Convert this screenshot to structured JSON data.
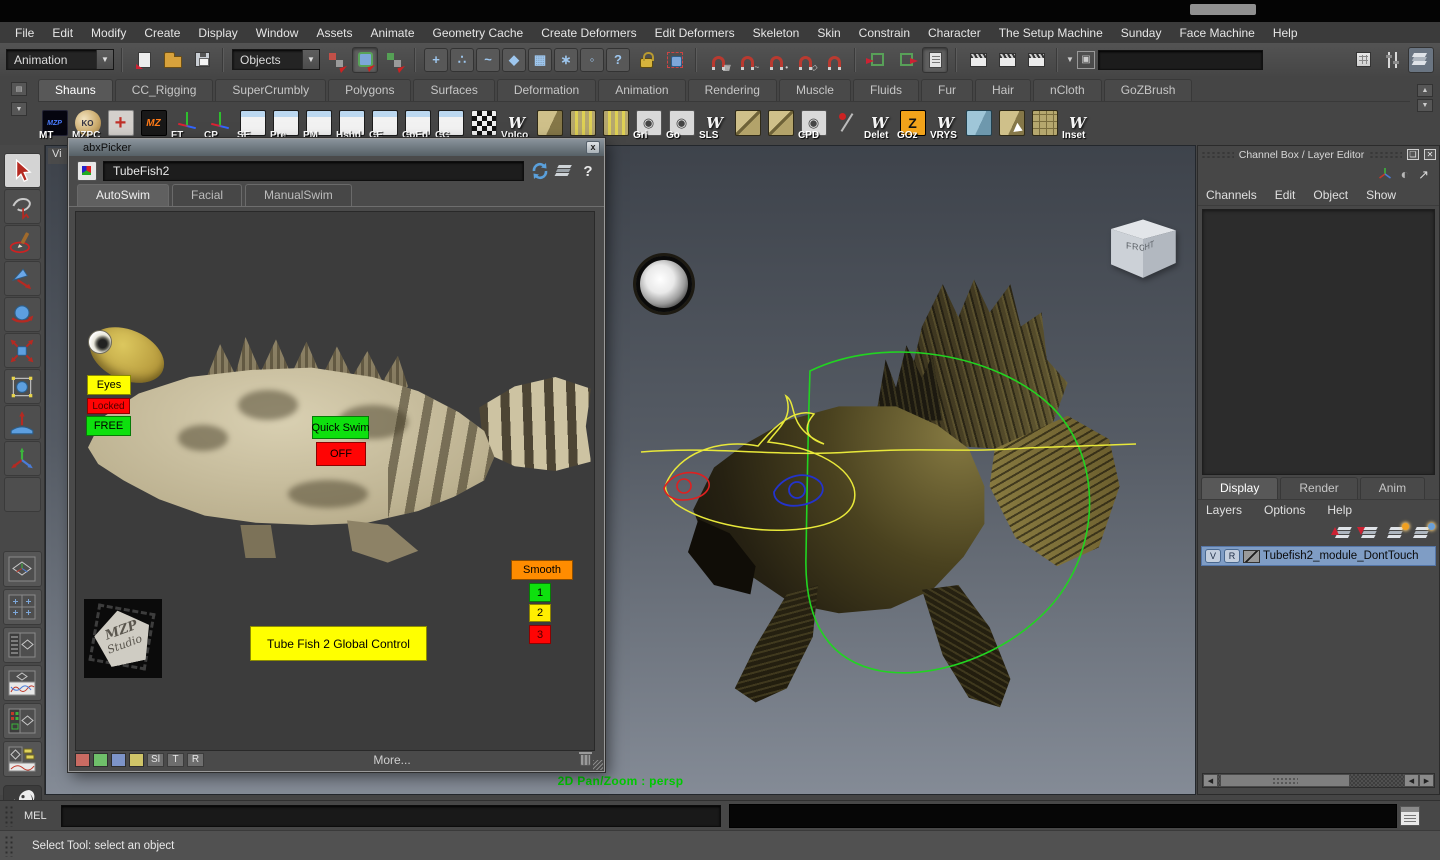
{
  "menubar": [
    "File",
    "Edit",
    "Modify",
    "Create",
    "Display",
    "Window",
    "Assets",
    "Animate",
    "Geometry Cache",
    "Create Deformers",
    "Edit Deformers",
    "Skeleton",
    "Skin",
    "Constrain",
    "Character",
    "The Setup Machine",
    "Sunday",
    "Face Machine",
    "Help"
  ],
  "statusline": {
    "menuset": "Animation",
    "selection_mask": "Objects",
    "component_mask_icons": [
      {
        "name": "select-all-icon",
        "glyph": "+"
      },
      {
        "name": "select-points-icon",
        "glyph": "∴"
      },
      {
        "name": "select-curves-icon",
        "glyph": "~"
      },
      {
        "name": "select-surfaces-icon",
        "glyph": "◆"
      },
      {
        "name": "select-hulls-icon",
        "glyph": "▦"
      },
      {
        "name": "select-deformations-icon",
        "glyph": "∗"
      },
      {
        "name": "select-dynamics-icon",
        "glyph": "◦"
      },
      {
        "name": "select-misc-icon",
        "glyph": "?"
      }
    ]
  },
  "shelf": {
    "tabs": [
      {
        "label": "Shauns",
        "state": "active"
      },
      {
        "label": "CC_Rigging",
        "state": ""
      },
      {
        "label": "SuperCrumbly",
        "state": ""
      },
      {
        "label": "Polygons",
        "state": ""
      },
      {
        "label": "Surfaces",
        "state": ""
      },
      {
        "label": "Deformation",
        "state": ""
      },
      {
        "label": "Animation",
        "state": ""
      },
      {
        "label": "Rendering",
        "state": ""
      },
      {
        "label": "Muscle",
        "state": ""
      },
      {
        "label": "Fluids",
        "state": ""
      },
      {
        "label": "Fur",
        "state": ""
      },
      {
        "label": "Hair",
        "state": ""
      },
      {
        "label": "nCloth",
        "state": ""
      },
      {
        "label": "GoZBrush",
        "state": ""
      }
    ],
    "items": [
      {
        "label": "MT",
        "kind": "mzp",
        "glyph": "MZP"
      },
      {
        "label": "MZPC",
        "kind": "globe",
        "glyph": "KO"
      },
      {
        "label": "",
        "kind": "cross",
        "glyph": "+"
      },
      {
        "label": "",
        "kind": "flame",
        "glyph": "MZ"
      },
      {
        "label": "FT",
        "kind": "axis",
        "glyph": ""
      },
      {
        "label": "CP",
        "kind": "axis",
        "glyph": ""
      },
      {
        "label": "SE",
        "kind": "win",
        "glyph": ""
      },
      {
        "label": "Pre",
        "kind": "win",
        "glyph": ""
      },
      {
        "label": "PM",
        "kind": "win",
        "glyph": ""
      },
      {
        "label": "Hshd",
        "kind": "win",
        "glyph": ""
      },
      {
        "label": "CE",
        "kind": "win",
        "glyph": ""
      },
      {
        "label": "CpEd",
        "kind": "win",
        "glyph": ""
      },
      {
        "label": "CC",
        "kind": "win",
        "glyph": ""
      },
      {
        "label": "",
        "kind": "checker",
        "glyph": ""
      },
      {
        "label": "VpIco",
        "kind": "wing",
        "glyph": "W"
      },
      {
        "label": "",
        "kind": "box",
        "glyph": ""
      },
      {
        "label": "",
        "kind": "planey",
        "glyph": ""
      },
      {
        "label": "",
        "kind": "planey",
        "glyph": ""
      },
      {
        "label": "Gri",
        "kind": "eye",
        "glyph": "◉"
      },
      {
        "label": "Go",
        "kind": "eye",
        "glyph": "◉"
      },
      {
        "label": "SLS",
        "kind": "wing",
        "glyph": "W"
      },
      {
        "label": "",
        "kind": "boxes",
        "glyph": ""
      },
      {
        "label": "",
        "kind": "boxes",
        "glyph": ""
      },
      {
        "label": "CPD",
        "kind": "eye",
        "glyph": "◉"
      },
      {
        "label": "",
        "kind": "pin",
        "glyph": ""
      },
      {
        "label": "Delet",
        "kind": "wing",
        "glyph": "W"
      },
      {
        "label": "GOz",
        "kind": "goz",
        "glyph": "Z"
      },
      {
        "label": "VRYS",
        "kind": "wing",
        "glyph": "W"
      },
      {
        "label": "",
        "kind": "planeb",
        "glyph": ""
      },
      {
        "label": "",
        "kind": "planea",
        "glyph": ""
      },
      {
        "label": "",
        "kind": "gridt",
        "glyph": ""
      },
      {
        "label": "Inset",
        "kind": "wing",
        "glyph": "W"
      }
    ]
  },
  "picker": {
    "title": "abxPicker",
    "close_label": "x",
    "character_name": "TubeFish2",
    "help_label": "?",
    "tabs": [
      {
        "label": "AutoSwim",
        "state": "active"
      },
      {
        "label": "Facial",
        "state": ""
      },
      {
        "label": "ManualSwim",
        "state": ""
      }
    ],
    "buttons": {
      "eyes": "Eyes",
      "locked": "Locked",
      "free": "FREE",
      "quick_swim": "Quick Swim",
      "off": "OFF",
      "smooth": "Smooth",
      "smooth1": "1",
      "smooth2": "2",
      "smooth3": "3",
      "global_control": "Tube Fish 2 Global Control"
    },
    "logo": {
      "line1": "MZP",
      "line2": "Studio"
    },
    "footer": {
      "select_label": "Sl",
      "translate_label": "T",
      "rotate_label": "R",
      "more_label": "More...",
      "swatch_colors": [
        "#c96b62",
        "#6fbf6a",
        "#7d94c9",
        "#cfc468"
      ]
    }
  },
  "viewport": {
    "panel_menu_clip": "Vi",
    "view_cube": {
      "front": "FRONT",
      "right": "RIGHT"
    },
    "overlay_text": "2D Pan/Zoom : persp"
  },
  "channel_box": {
    "title": "Channel Box / Layer Editor",
    "menus": [
      "Channels",
      "Edit",
      "Object",
      "Show"
    ],
    "layer_editor": {
      "tabs": [
        {
          "label": "Display",
          "state": "active"
        },
        {
          "label": "Render",
          "state": ""
        },
        {
          "label": "Anim",
          "state": ""
        }
      ],
      "menus": [
        "Layers",
        "Options",
        "Help"
      ],
      "layers": [
        {
          "visible_label": "V",
          "render_label": "R",
          "name": "Tubefish2_module_DontTouch",
          "selected": true
        }
      ]
    }
  },
  "command_line": {
    "label": "MEL"
  },
  "help_line": {
    "text": "Select Tool: select an object"
  },
  "colors": {
    "button_yellow": "#ffff00",
    "button_red": "#ff0404",
    "button_green": "#0ee00e",
    "button_orange": "#ff8c00",
    "layer_selected": "#7f9dc5",
    "overlay_green": "#00c800"
  }
}
